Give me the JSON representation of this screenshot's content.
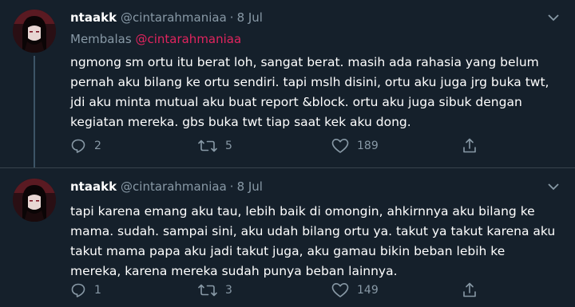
{
  "tweets": [
    {
      "display_name": "ntaakk",
      "handle": "@cintarahmaniaa",
      "separator": "·",
      "date": "8 Jul",
      "reply_prefix": "Membalas",
      "reply_mention": "@cintarahmaniaa",
      "lines": [
        "ngmong sm ortu itu berat loh, sangat berat. masih ada rahasia yang belum",
        "pernah aku bilang ke ortu sendiri. tapi mslh disini, ortu aku juga jrg buka twt,",
        "jdi aku minta mutual aku buat report &block. ortu aku juga sibuk dengan",
        "kegiatan mereka. gbs buka twt tiap saat kek aku dong."
      ],
      "replies": "2",
      "retweets": "5",
      "likes": "189"
    },
    {
      "display_name": "ntaakk",
      "handle": "@cintarahmaniaa",
      "separator": "·",
      "date": "8 Jul",
      "lines": [
        "tapi karena emang aku tau, lebih baik di omongin, ahkirnnya aku bilang ke",
        "mama. sudah. sampai sini, aku udah bilang ortu ya. takut ya takut karena aku",
        "takut mama papa aku jadi takut juga, aku gamau bikin beban lebih ke",
        "mereka, karena mereka sudah punya beban lainnya."
      ],
      "replies": "1",
      "retweets": "3",
      "likes": "149"
    }
  ],
  "icons": {
    "caret": "chevron-down-icon",
    "reply": "reply-icon",
    "retweet": "retweet-icon",
    "like": "heart-icon",
    "share": "share-icon"
  },
  "colors": {
    "background": "#15202b",
    "secondary_text": "#8899a6",
    "mention": "#e0245e",
    "divider": "#38444d"
  }
}
